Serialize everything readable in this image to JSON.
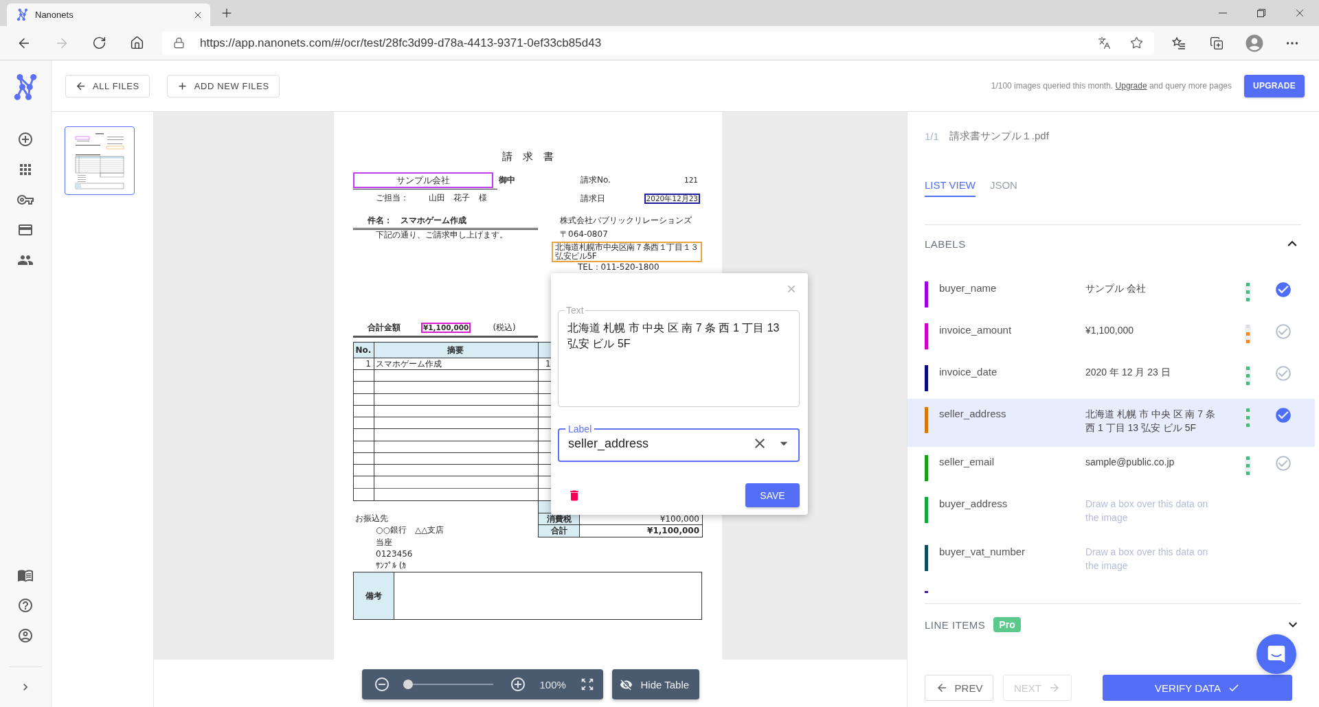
{
  "browser": {
    "tab": {
      "title": "Nanonets",
      "selected": true
    },
    "url": "https://app.nanonets.com/#/ocr/test/28fc3d99-d78a-4413-9371-0ef33cb85d43",
    "forward": {
      "disabled": true
    }
  },
  "header": {
    "buttons": [
      {
        "kind": "back",
        "label": "ALL FILES"
      },
      {
        "kind": "add",
        "label": "ADD NEW FILES"
      }
    ],
    "usage_note": {
      "text": "1/100 images queried this month.",
      "link": "Upgrade",
      "after": "and query more pages"
    },
    "upgrade_button": "UPGRADE"
  },
  "thumbnails": [
    {
      "selected": true
    }
  ],
  "document": {
    "title": "請　求　書",
    "recipient": {
      "name": "サンプル会社",
      "suffix": "御中",
      "color": "#c23cf2"
    },
    "contact": {
      "label": "ご担当：",
      "name": "山田　花子",
      "suffix": "様"
    },
    "meta": [
      {
        "label": "請求No.",
        "value": "121"
      },
      {
        "label": "請求日",
        "value": "2020年12月23",
        "color": "#1c1c9c"
      }
    ],
    "subject": "件名：　スマホゲーム作成",
    "greeting": "下記の通り、ご請求申し上げます。",
    "issuer": {
      "company": "株式会社パブリックリレーションズ",
      "postal": "〒064-0807",
      "address": [
        "北海道札幌市中央区南７条西１丁目１３",
        "弘安ビル5F"
      ],
      "color": "#eba33e",
      "tel": "TEL：011-520-1800"
    },
    "total": {
      "label": "合計金額",
      "value": "¥1,100,000",
      "color": "#d81bd0",
      "note": "(税込)"
    },
    "items": {
      "columns": [
        "No.",
        "摘要"
      ],
      "rows": [
        {
          "no": "1",
          "description": "スマホゲーム作成",
          "quantity": "1"
        }
      ]
    },
    "summary": [
      {
        "label": "消費税",
        "value": "¥100,000"
      },
      {
        "label": "合計",
        "value": "¥1,100,000"
      }
    ],
    "bank": {
      "title": "お振込先",
      "lines": [
        "○○銀行　△△支店",
        "当座",
        "0123456",
        "ｻﾝﾌﾟﾙ (ｶ"
      ]
    },
    "remarks": "備考"
  },
  "viewer_toolbar": {
    "level": 0,
    "zoom_text": "100%",
    "hide_table_button": "Hide Table"
  },
  "dialog": {
    "text_field": {
      "label": "Text",
      "value": "北海道 札幌 市 中央 区 南 7 条 西 1 丁目 13 弘安 ビル 5F"
    },
    "label_field": {
      "label": "Label",
      "value": "seller_address",
      "focused": true
    },
    "save_button": "SAVE"
  },
  "panel": {
    "page_counter": "1/1",
    "file_name": "請求書サンプル１.pdf",
    "tabs": [
      {
        "label": "LIST VIEW",
        "selected": true
      },
      {
        "label": "JSON",
        "selected": false
      }
    ],
    "labels_section": {
      "title": "LABELS",
      "expanded": true
    },
    "labels": [
      {
        "kind": "filled",
        "name": "buyer_name",
        "color": "#a000e0",
        "value": "サンプル 会社",
        "level": 1,
        "verified": true,
        "selected": false
      },
      {
        "kind": "filled",
        "name": "invoice_amount",
        "color": "#d400c8",
        "value": "¥1,100,000",
        "level": 0.67,
        "verified": false,
        "selected": false
      },
      {
        "kind": "filled",
        "name": "invoice_date",
        "color": "#0c0c80",
        "value": "2020 年 12 月 23 日",
        "level": 1,
        "verified": false,
        "selected": false
      },
      {
        "kind": "filled",
        "name": "seller_address",
        "color": "#d4780a",
        "value": [
          "北海道 札幌 市 中央 区 南 7 条",
          "西 1 丁目 13 弘安 ビル 5F"
        ],
        "level": 1,
        "verified": true,
        "selected": true
      },
      {
        "kind": "filled",
        "name": "seller_email",
        "color": "#18a018",
        "value": "sample@public.co.jp",
        "level": 1,
        "verified": false,
        "selected": false
      },
      {
        "kind": "empty",
        "name": "buyer_address",
        "color": "#10a83a",
        "hint": "Draw a box over this data on the image",
        "selected": false
      },
      {
        "kind": "empty",
        "name": "buyer_vat_number",
        "color": "#0d4d5e",
        "hint": "Draw a box over this data on the image",
        "selected": false
      },
      {
        "kind": "cut_off",
        "color": "#3c1a9a"
      }
    ],
    "line_items_section": {
      "title": "LINE ITEMS",
      "badge": "Pro",
      "expanded": false
    },
    "buttons": [
      {
        "kind": "prev",
        "label": "PREV",
        "disabled": false
      },
      {
        "kind": "next",
        "label": "NEXT",
        "disabled": true
      },
      {
        "kind": "verify",
        "label": "VERIFY DATA",
        "disabled": false
      }
    ]
  }
}
